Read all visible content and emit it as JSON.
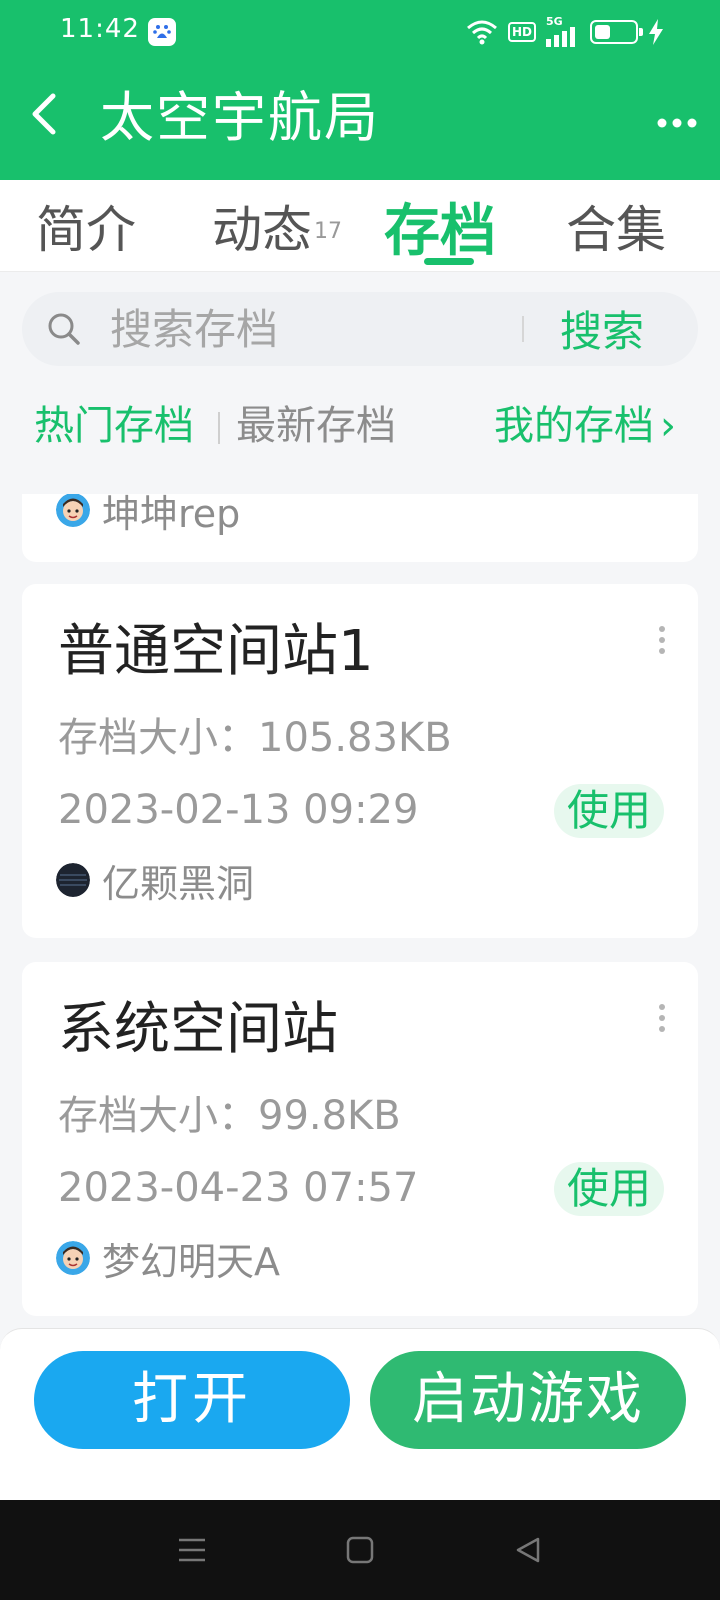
{
  "status_bar": {
    "time": "11:42",
    "hd_label": "HD",
    "network": "5G",
    "battery_level": 0.35
  },
  "app_bar": {
    "title": "太空宇航局",
    "back_icon": "chevron-left-icon",
    "more_icon": "more-dots-icon"
  },
  "tabs": [
    {
      "label": "简介",
      "count": ""
    },
    {
      "label": "动态",
      "count": "17"
    },
    {
      "label": "存档",
      "count": ""
    },
    {
      "label": "合集",
      "count": ""
    }
  ],
  "active_tab": "存档",
  "search": {
    "placeholder": "搜索存档",
    "value": "",
    "button_label": "搜索"
  },
  "filters": {
    "hot": "热门存档",
    "latest": "最新存档",
    "mine": "我的存档",
    "mine_arrow": "›"
  },
  "archives": [
    {
      "title": "",
      "size_label": "",
      "date": "",
      "use_label": "",
      "author": "坤坤rep",
      "avatar": "cartoon-face-avatar"
    },
    {
      "title": "普通空间站1",
      "size_label": "存档大小：105.83KB",
      "date": "2023-02-13 09:29",
      "use_label": "使用",
      "author": "亿颗黑洞",
      "avatar": "dark-planet-avatar"
    },
    {
      "title": "系统空间站",
      "size_label": "存档大小：99.8KB",
      "date": "2023-04-23 07:57",
      "use_label": "使用",
      "author": "梦幻明天A",
      "avatar": "cartoon-face-avatar"
    }
  ],
  "bottom_buttons": {
    "open": "打开",
    "start": "启动游戏"
  },
  "colors": {
    "primary_green": "#18c06c",
    "open_blue": "#1aa8f0",
    "start_green": "#2fba72",
    "nav_bar": "#111111"
  }
}
